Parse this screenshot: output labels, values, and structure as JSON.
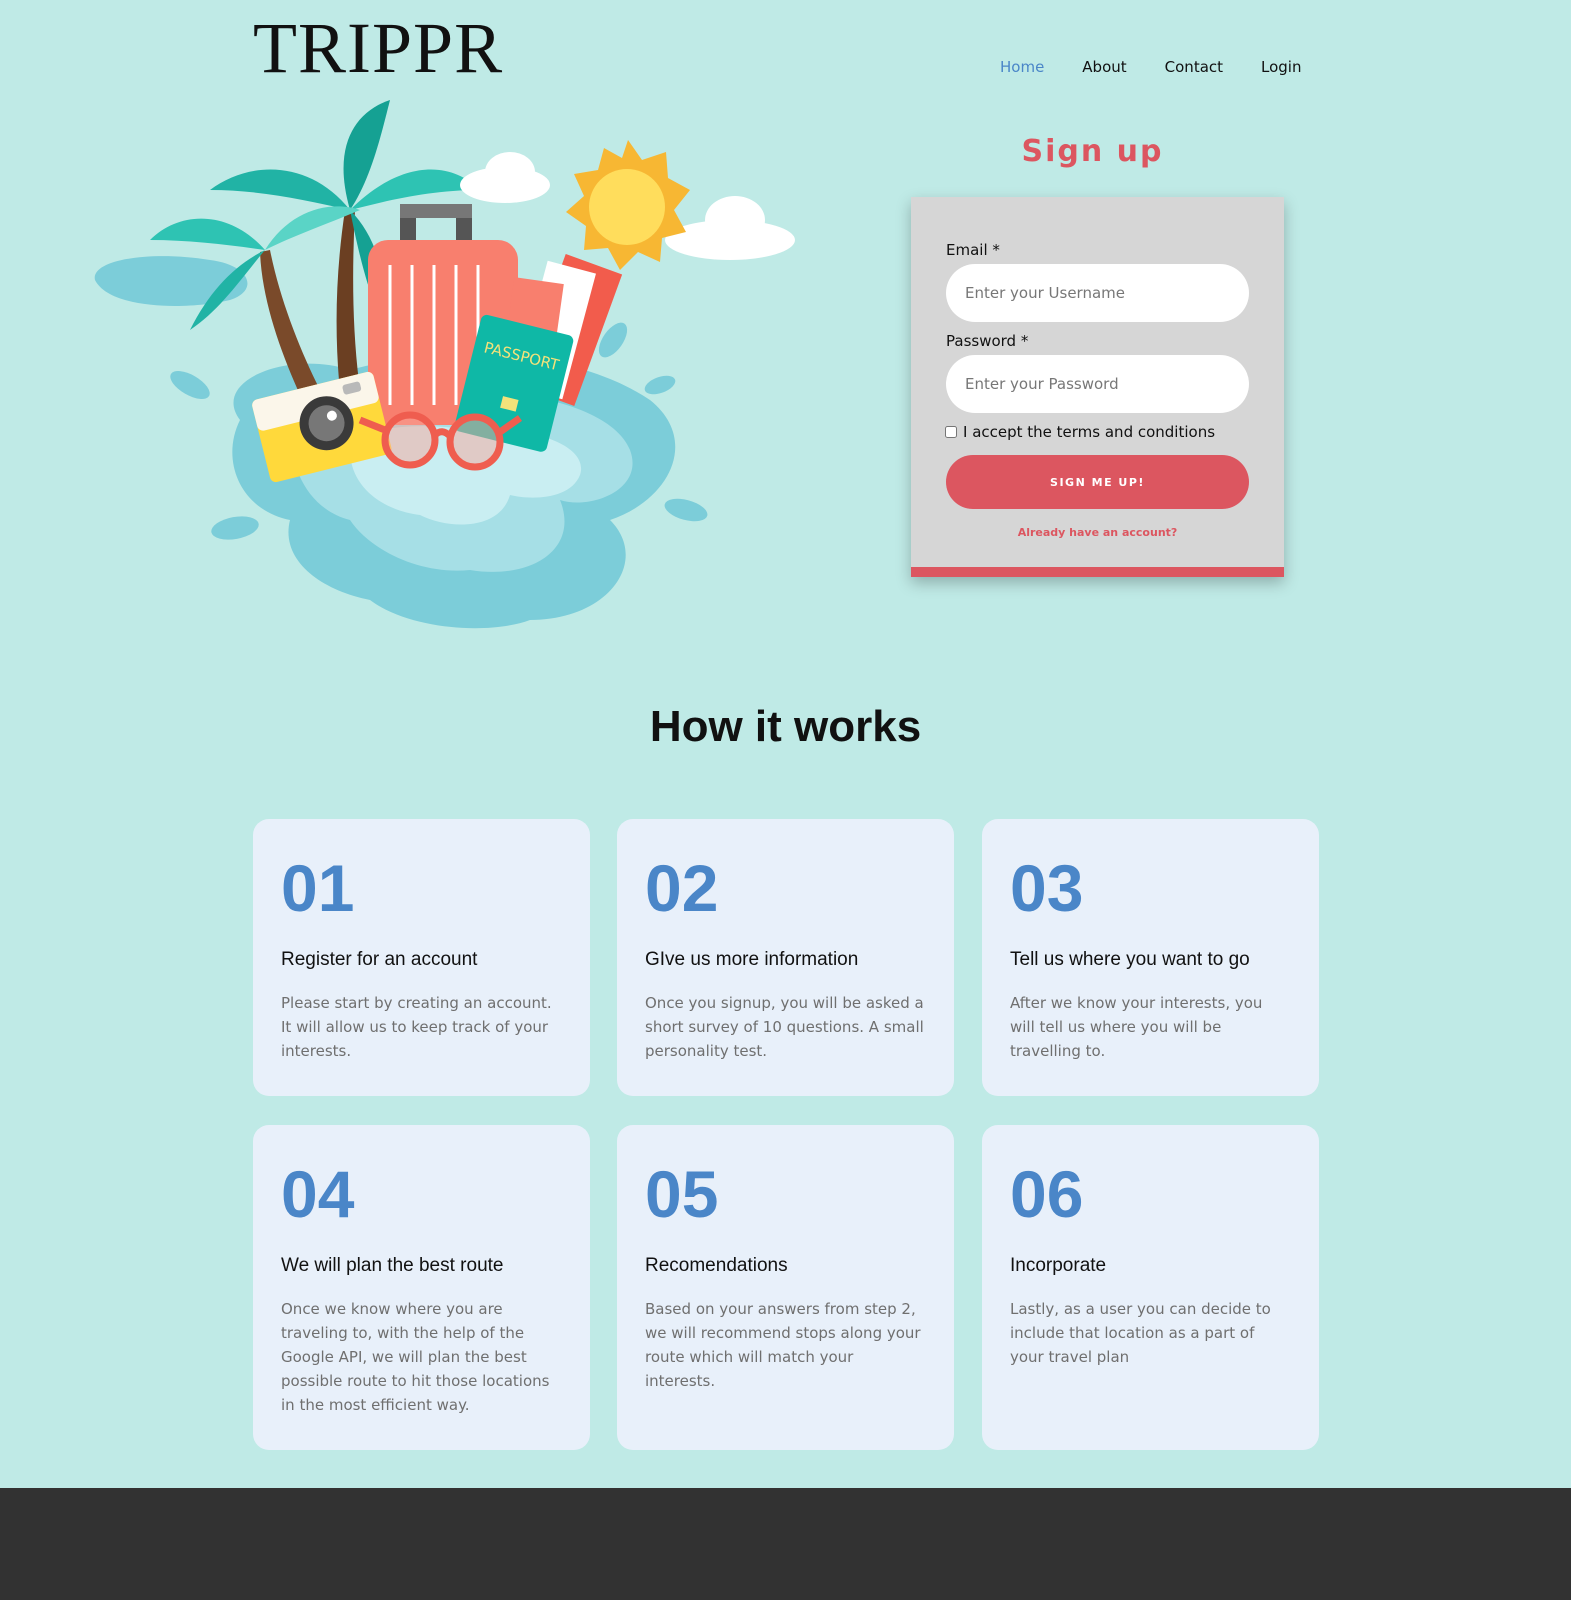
{
  "header": {
    "logo": "TRIPPR",
    "nav": [
      {
        "label": "Home",
        "active": true
      },
      {
        "label": "About",
        "active": false
      },
      {
        "label": "Contact",
        "active": false
      },
      {
        "label": "Login",
        "active": false
      }
    ]
  },
  "hero": {
    "illustration_text": "PASSPORT"
  },
  "signup": {
    "title": "Sign up",
    "email_label": "Email *",
    "email_placeholder": "Enter your Username",
    "password_label": "Password *",
    "password_placeholder": "Enter your Password",
    "terms_label": "I accept the terms and conditions",
    "button_label": "SIGN ME UP!",
    "login_link": "Already have an account?"
  },
  "how_it_works": {
    "title": "How it works",
    "steps": [
      {
        "number": "01",
        "title": "Register for an account",
        "desc": "Please start by creating an account. It will allow us to keep track of your interests."
      },
      {
        "number": "02",
        "title": "GIve us more information",
        "desc": "Once you signup, you will be asked a short survey of 10 questions. A small personality test."
      },
      {
        "number": "03",
        "title": "Tell us where you want to go",
        "desc": "After we know your interests, you will tell us where you will be travelling to."
      },
      {
        "number": "04",
        "title": "We will plan the best route",
        "desc": "Once we know where you are traveling to, with the help of the Google API, we will plan the best possible route to hit those locations in the most efficient way."
      },
      {
        "number": "05",
        "title": "Recomendations",
        "desc": "Based on your answers from step 2, we will recommend stops along your route which will match your interests."
      },
      {
        "number": "06",
        "title": "Incorporate",
        "desc": "Lastly, as a user you can decide to include that location as a part of your travel plan"
      }
    ]
  },
  "colors": {
    "background": "#bfeae6",
    "accent": "#dc5660",
    "link_active": "#4a86c8",
    "card": "#e8f0fa",
    "footer": "#323232"
  }
}
